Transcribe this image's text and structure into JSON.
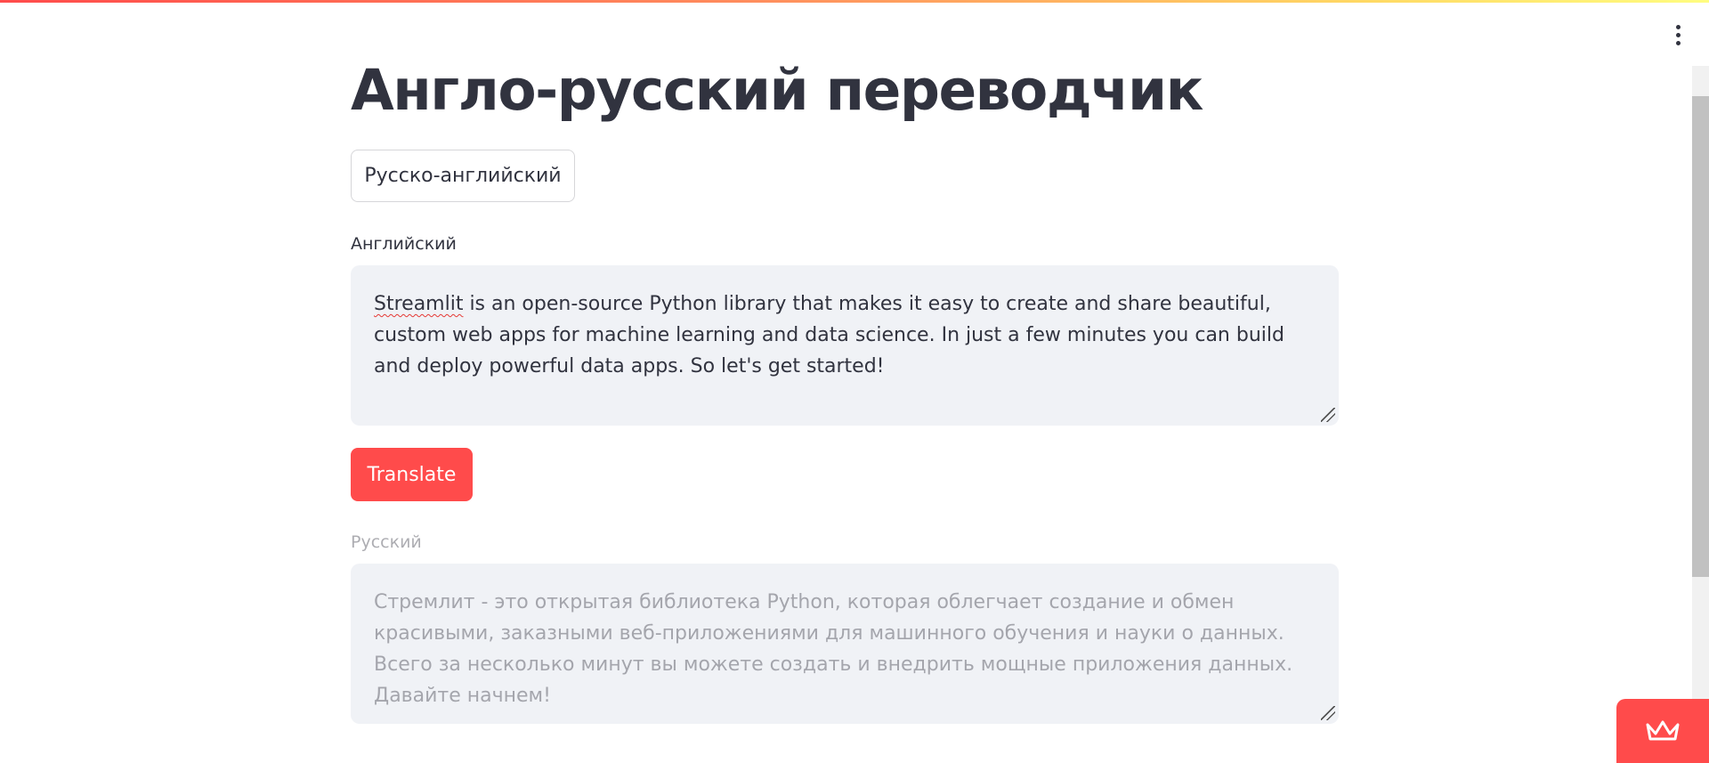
{
  "app": {
    "title": "Англо-русский переводчик",
    "mode_button_label": "Русско-английский"
  },
  "source": {
    "label": "Английский",
    "spellcheck_word": "Streamlit",
    "text_rest": " is an open-source Python library that makes it easy to create and share beautiful, custom web apps for machine learning and data science. In just a few minutes you can build and deploy powerful data apps. So let's get started!"
  },
  "actions": {
    "translate_label": "Translate"
  },
  "output": {
    "label": "Русский",
    "text": "Стремлит - это открытая библиотека Python, которая облегчает создание и обмен красивыми, заказными веб-приложениями для машинного обучения и науки о данных. Всего за несколько минут вы можете создать и внедрить мощные приложения данных. Давайте начнем!"
  },
  "icons": {
    "menu": "kebab-menu-icon",
    "badge": "crown-icon"
  },
  "colors": {
    "primary": "#ff4b4b",
    "text": "#31333f",
    "input_background": "#f0f2f6"
  }
}
